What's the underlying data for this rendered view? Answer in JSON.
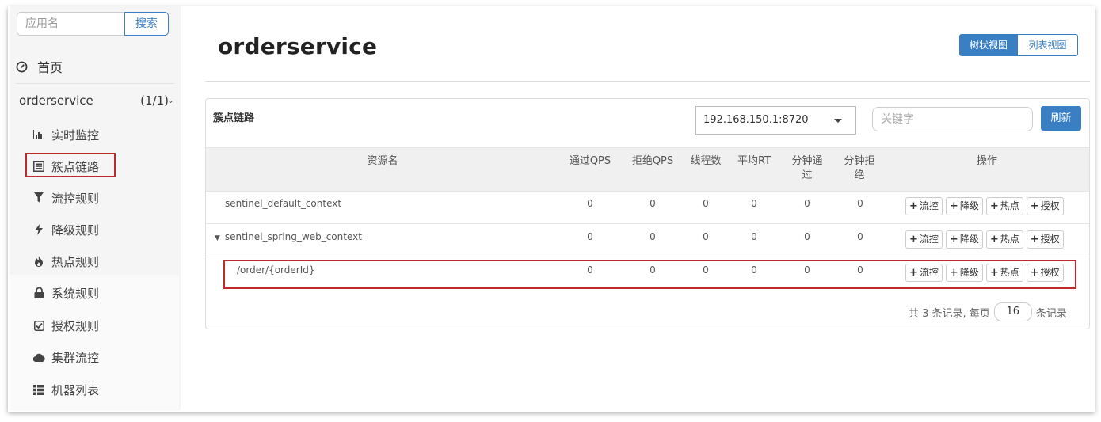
{
  "sidebar": {
    "search_placeholder": "应用名",
    "search_button": "搜索",
    "home_label": "首页",
    "app_name": "orderservice",
    "app_count": "(1/1)",
    "menu": [
      {
        "label": "实时监控",
        "icon": "bar-chart-icon"
      },
      {
        "label": "簇点链路",
        "icon": "list-alt-icon"
      },
      {
        "label": "流控规则",
        "icon": "filter-icon"
      },
      {
        "label": "降级规则",
        "icon": "flash-icon"
      },
      {
        "label": "热点规则",
        "icon": "fire-icon"
      },
      {
        "label": "系统规则",
        "icon": "lock-icon"
      },
      {
        "label": "授权规则",
        "icon": "check-icon"
      },
      {
        "label": "集群流控",
        "icon": "cloud-icon"
      },
      {
        "label": "机器列表",
        "icon": "th-list-icon"
      }
    ]
  },
  "main": {
    "title": "orderservice",
    "view_tree": "树状视图",
    "view_list": "列表视图",
    "panel_title": "簇点链路",
    "machine": "192.168.150.1:8720",
    "keyword_placeholder": "关键字",
    "refresh": "刷新",
    "columns": {
      "resource": "资源名",
      "pass_qps": "通过QPS",
      "block_qps": "拒绝QPS",
      "threads": "线程数",
      "avg_rt": "平均RT",
      "minute_pass_1": "分钟通",
      "minute_pass_2": "过",
      "minute_block_1": "分钟拒",
      "minute_block_2": "绝",
      "ops": "操作"
    },
    "rows": [
      {
        "name": "sentinel_default_context",
        "pass_qps": "0",
        "block_qps": "0",
        "threads": "0",
        "avg_rt": "0",
        "minute_pass": "0",
        "minute_block": "0"
      },
      {
        "name": "sentinel_spring_web_context",
        "pass_qps": "0",
        "block_qps": "0",
        "threads": "0",
        "avg_rt": "0",
        "minute_pass": "0",
        "minute_block": "0"
      },
      {
        "name": "/order/{orderId}",
        "pass_qps": "0",
        "block_qps": "0",
        "threads": "0",
        "avg_rt": "0",
        "minute_pass": "0",
        "minute_block": "0"
      }
    ],
    "op_buttons": {
      "flow": "流控",
      "degrade": "降级",
      "hot": "热点",
      "auth": "授权"
    },
    "pager": {
      "prefix": "共 3 条记录, 每页",
      "page_size": "16",
      "suffix": "条记录"
    }
  }
}
